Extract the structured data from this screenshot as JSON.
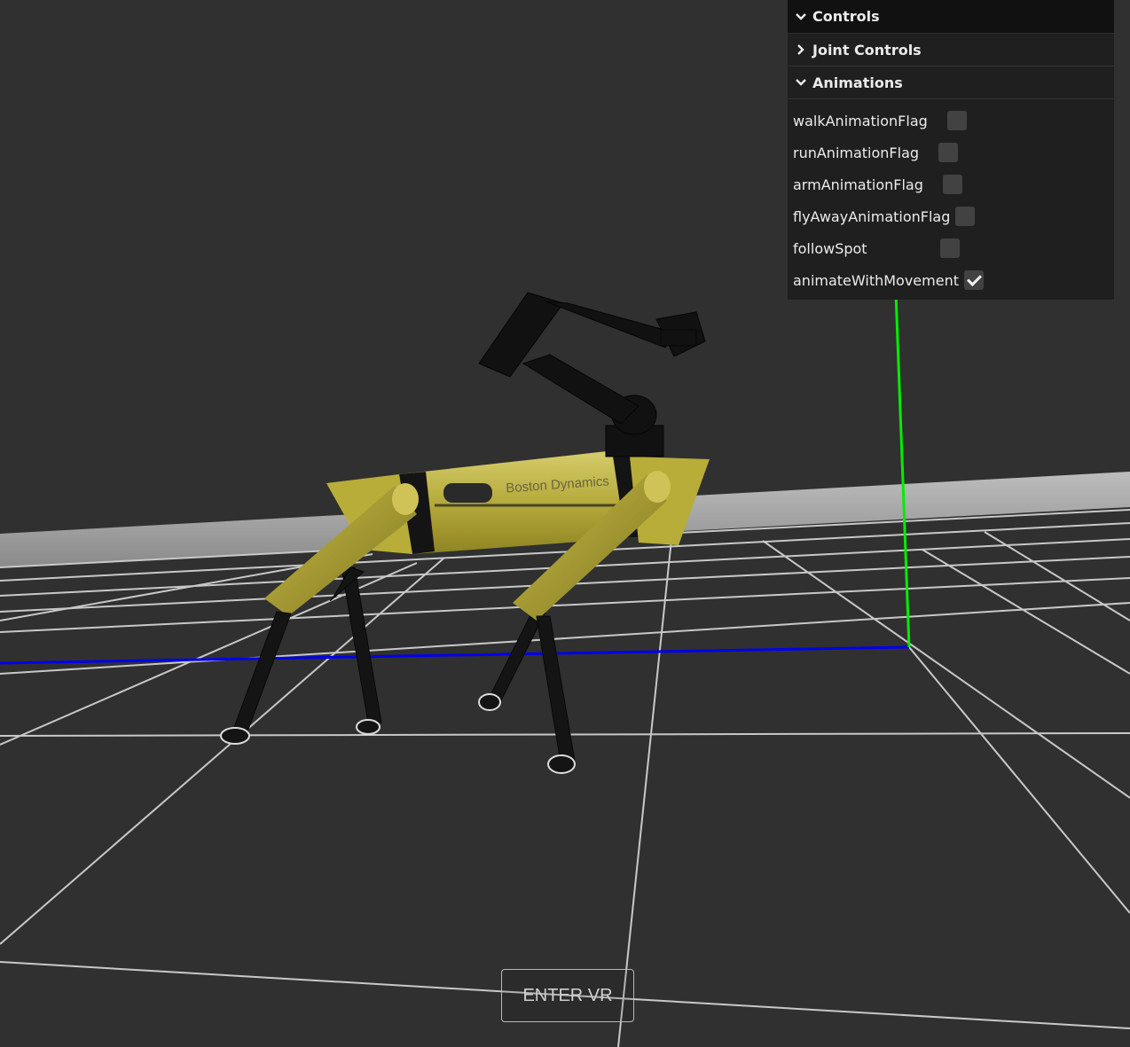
{
  "gui": {
    "title": "Controls",
    "folders": [
      {
        "title": "Joint Controls",
        "collapsed": true
      },
      {
        "title": "Animations",
        "collapsed": false
      }
    ],
    "animations": [
      {
        "label": "walkAnimationFlag",
        "checked": false
      },
      {
        "label": "runAnimationFlag",
        "checked": false
      },
      {
        "label": "armAnimationFlag",
        "checked": false
      },
      {
        "label": "flyAwayAnimationFlag",
        "checked": false
      },
      {
        "label": "followSpot",
        "checked": false
      },
      {
        "label": "animateWithMovement",
        "checked": true
      }
    ]
  },
  "scene": {
    "robot_logo_text": "Boston Dynamics",
    "colors": {
      "background": "#303030",
      "grid": "#c8c8c8",
      "y_axis": "#00ff00",
      "x_axis": "#0000ff",
      "body_yellow": "#b3a530",
      "body_black": "#151515"
    }
  },
  "vr_button": {
    "label": "ENTER VR"
  }
}
